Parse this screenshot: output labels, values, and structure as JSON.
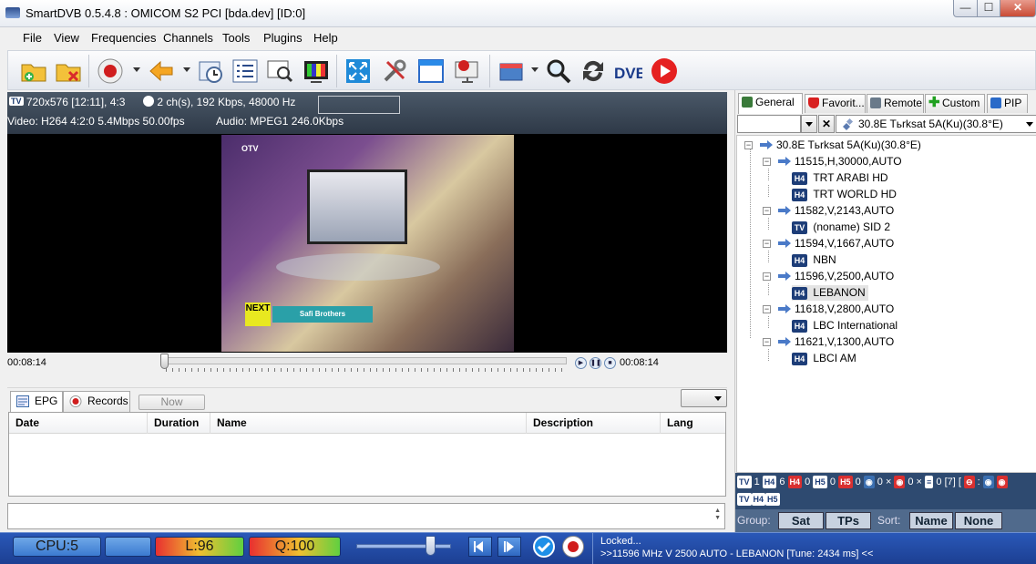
{
  "window": {
    "title": "SmartDVB 0.5.4.8 : OMICOM S2 PCI [bda.dev]  [ID:0]",
    "min": "—",
    "max": "☐",
    "close": "✕"
  },
  "menu": [
    "File",
    "View",
    "Frequencies",
    "Channels",
    "Tools",
    "Plugins",
    "Help"
  ],
  "info": {
    "badge": "TV",
    "resolution": "720x576 [12:11], 4:3",
    "audio_channels": "2 ch(s), 192 Kbps, 48000 Hz",
    "video": "Video: H264  4:2:0  5.4Mbps  50.00fps",
    "audio": "Audio: MPEG1  246.0Kbps"
  },
  "video_frame": {
    "logo": "OTV",
    "overlay_logo": "NEXT",
    "banner": "Safi Brothers"
  },
  "seek": {
    "time_left": "00:08:14",
    "time_right": "00:08:14"
  },
  "lower_tabs": [
    "EPG",
    "Records"
  ],
  "now_button": "Now",
  "epg_columns": [
    "Date",
    "Duration",
    "Name",
    "Description",
    "Lang"
  ],
  "right_tabs": [
    "General",
    "Favorit...",
    "Remote",
    "Custom",
    "PIP"
  ],
  "satellite_select": "30.8E  Tьrksat 5A(Ku)(30.8°E)",
  "tree": {
    "root": "30.8E  Tьrksat 5A(Ku)(30.8°E)",
    "transponders": [
      {
        "label": "11515,H,30000,AUTO",
        "channels": [
          {
            "type": "H4",
            "name": "TRT ARABI HD"
          },
          {
            "type": "H4",
            "name": "TRT WORLD HD"
          }
        ]
      },
      {
        "label": "11582,V,2143,AUTO",
        "channels": [
          {
            "type": "TV",
            "name": "(noname) SID 2"
          }
        ]
      },
      {
        "label": "11594,V,1667,AUTO",
        "channels": [
          {
            "type": "H4",
            "name": "NBN"
          }
        ]
      },
      {
        "label": "11596,V,2500,AUTO",
        "channels": [
          {
            "type": "H4",
            "name": "LEBANON"
          }
        ]
      },
      {
        "label": "11618,V,2800,AUTO",
        "channels": [
          {
            "type": "H4",
            "name": "LBC International"
          }
        ]
      },
      {
        "label": "11621,V,1300,AUTO",
        "channels": [
          {
            "type": "H4",
            "name": "LBCI AM"
          }
        ]
      }
    ]
  },
  "stats": {
    "tv": "TV",
    "tv_count": "1",
    "h4": "H4",
    "h4_count": "6",
    "h4r": "H4",
    "h4r_count": "0",
    "h5": "H5",
    "h5_count": "0",
    "h5r": "H5",
    "h5r_count": "0",
    "c1_count": "0",
    "x1": "×",
    "c2_count": "0",
    "x2": "×",
    "c3_count": "0",
    "total": "[7]",
    "bracket": "[",
    "row2": [
      "TV",
      "H4",
      "H5"
    ]
  },
  "group": {
    "group_label": "Group:",
    "sat": "Sat",
    "tps": "TPs",
    "sort_label": "Sort:",
    "name": "Name",
    "none": "None"
  },
  "status": {
    "cpu": "CPU:5",
    "level": "L:96",
    "quality": "Q:100",
    "volume_fraction": 0.78,
    "line1": "Locked...",
    "line2": ">>11596 MHz V 2500 AUTO - LEBANON [Tune: 2434 ms] <<"
  }
}
